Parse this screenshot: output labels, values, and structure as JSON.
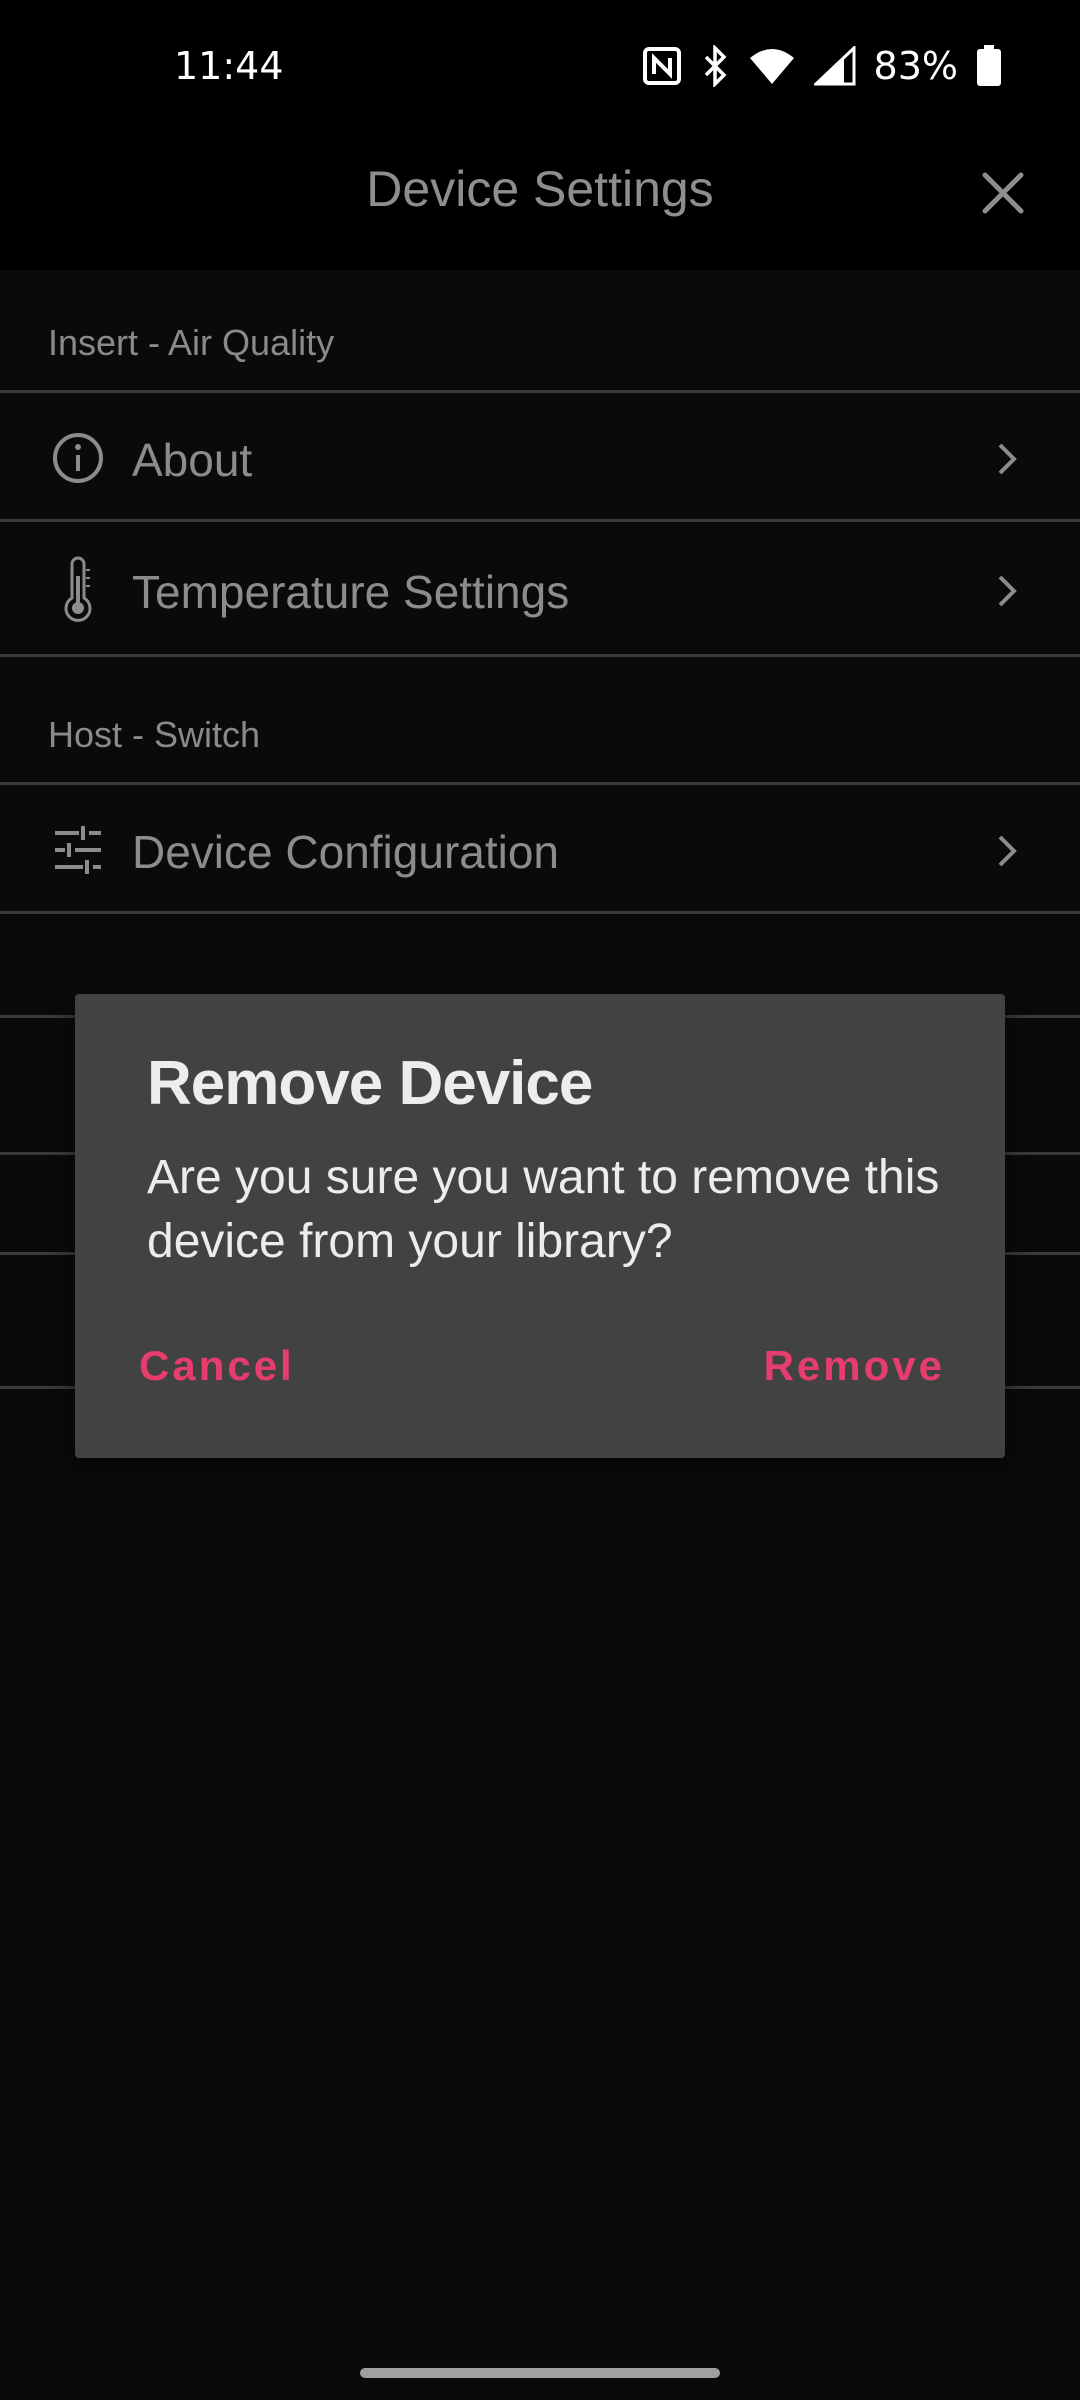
{
  "status_bar": {
    "time": "11:44",
    "battery": "83%",
    "icons": [
      "nfc-icon",
      "bluetooth-icon",
      "wifi-icon",
      "signal-icon",
      "battery-icon"
    ]
  },
  "app_bar": {
    "title": "Device Settings",
    "close_icon": "close-icon"
  },
  "sections": [
    {
      "header": "Insert - Air Quality",
      "items": [
        {
          "label": "About",
          "icon": "info-icon"
        },
        {
          "label": "Temperature Settings",
          "icon": "thermometer-icon"
        }
      ]
    },
    {
      "header": "Host - Switch",
      "items": [
        {
          "label": "Device Configuration",
          "icon": "sliders-icon"
        }
      ]
    }
  ],
  "dialog": {
    "title": "Remove Device",
    "message": "Are you sure you want to remove this device from your library?",
    "cancel_label": "Cancel",
    "confirm_label": "Remove"
  },
  "colors": {
    "accent": "#E63D6E",
    "dialog_bg": "#424242",
    "background": "#0A0A0A"
  }
}
